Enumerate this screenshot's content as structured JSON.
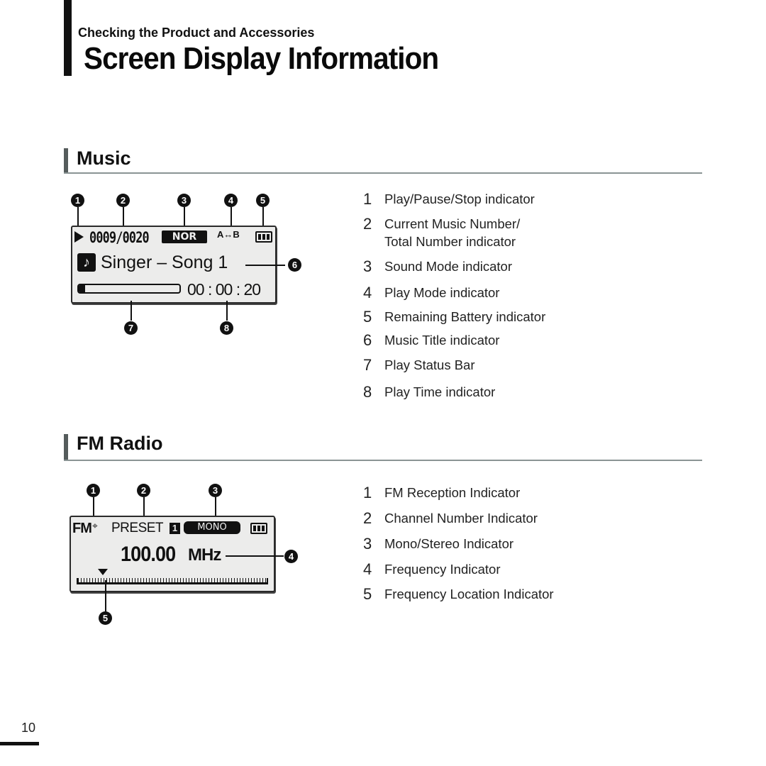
{
  "header": {
    "subtitle": "Checking the Product and Accessories",
    "title": "Screen Display Information"
  },
  "music": {
    "heading": "Music",
    "display": {
      "play_state_icon": "play-triangle-icon",
      "track_counter": "0009/0020",
      "sound_mode": "NOR",
      "play_mode": "A↔B",
      "battery_icon": "battery-full-icon",
      "note_icon": "music-note-icon",
      "song_title": "Singer – Song 1",
      "play_time": "00 : 00 : 20",
      "progress_fraction": 0.06
    },
    "callouts": [
      "1",
      "2",
      "3",
      "4",
      "5",
      "6",
      "7",
      "8"
    ],
    "legend": [
      {
        "num": "1",
        "label": "Play/Pause/Stop indicator"
      },
      {
        "num": "2",
        "label": "Current Music Number/",
        "label2": "Total Number indicator"
      },
      {
        "num": "3",
        "label": "Sound Mode indicator"
      },
      {
        "num": "4",
        "label": "Play Mode indicator"
      },
      {
        "num": "5",
        "label": "Remaining Battery indicator"
      },
      {
        "num": "6",
        "label": "Music Title indicator"
      },
      {
        "num": "7",
        "label": "Play Status Bar"
      },
      {
        "num": "8",
        "label": "Play Time indicator"
      }
    ]
  },
  "fm": {
    "heading": "FM Radio",
    "display": {
      "fm_label": "FM",
      "reception_icon": "antenna-signal-icon",
      "preset_label": "PRESET",
      "preset_number": "1",
      "audio_mode": "MONO",
      "battery_icon": "battery-full-icon",
      "frequency": "100.00",
      "unit": "MHz",
      "location_fraction": 0.14
    },
    "callouts": [
      "1",
      "2",
      "3",
      "4",
      "5"
    ],
    "legend": [
      {
        "num": "1",
        "label": "FM Reception Indicator"
      },
      {
        "num": "2",
        "label": "Channel Number Indicator"
      },
      {
        "num": "3",
        "label": "Mono/Stereo Indicator"
      },
      {
        "num": "4",
        "label": "Frequency Indicator"
      },
      {
        "num": "5",
        "label": "Frequency Location Indicator"
      }
    ]
  },
  "footer": {
    "page_number": "10"
  }
}
